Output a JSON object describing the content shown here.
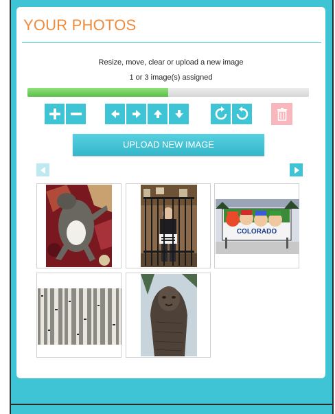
{
  "panel": {
    "title": "YOUR PHOTOS",
    "instructions": "Resize, move, clear or upload a new image",
    "assigned_text": "1 or 3 image(s) assigned"
  },
  "progress": {
    "fraction": 0.5
  },
  "toolbar": {
    "groups": [
      [
        "zoom-in-icon",
        "zoom-out-icon"
      ],
      [
        "move-left-icon",
        "move-right-icon",
        "move-up-icon",
        "move-down-icon"
      ],
      [
        "rotate-clockwise-icon",
        "rotate-counterclockwise-icon"
      ]
    ],
    "delete_icon": "trash-icon"
  },
  "upload_button": {
    "label": "UPLOAD NEW IMAGE"
  },
  "pagination": {
    "prev_icon": "arrow-left-icon",
    "next_icon": "arrow-right-icon"
  },
  "photos": [
    {
      "name": "cat-on-rug"
    },
    {
      "name": "man-in-jail-cell"
    },
    {
      "name": "south-park-colorado-sign",
      "sign_text": "COLORADO"
    },
    {
      "name": "birch-forest"
    },
    {
      "name": "bigfoot-statue"
    }
  ],
  "colors": {
    "accent": "#3fc4d6",
    "title": "#f08a3a",
    "progress": "#5cbf4a",
    "delete": "#f7b7bd"
  }
}
